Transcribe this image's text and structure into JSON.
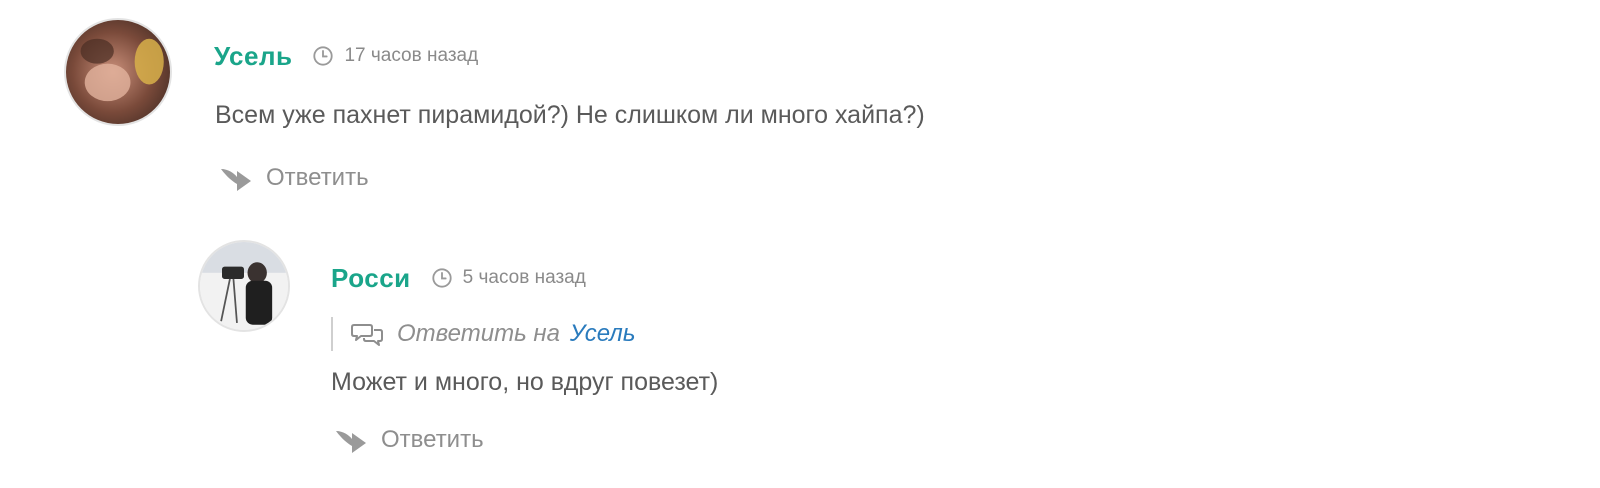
{
  "comments": [
    {
      "author": "Усель",
      "time": "17 часов назад",
      "text": "Всем уже пахнет пирамидой?) Не слишком ли много хайпа?)",
      "reply_label": "Ответить"
    },
    {
      "author": "Росси",
      "time": "5 часов назад",
      "quote_prefix": "Ответить на",
      "quote_author": "Усель",
      "text": "Может и много, но вдруг повезет)",
      "reply_label": "Ответить"
    }
  ],
  "colors": {
    "author": "#1aa58a",
    "link": "#2a7bbd",
    "text": "#5a5a5a",
    "muted": "#8e8e8e"
  },
  "icons": {
    "time": "clock-icon",
    "reply": "reply-arrow-icon",
    "quote": "speech-bubbles-icon"
  }
}
